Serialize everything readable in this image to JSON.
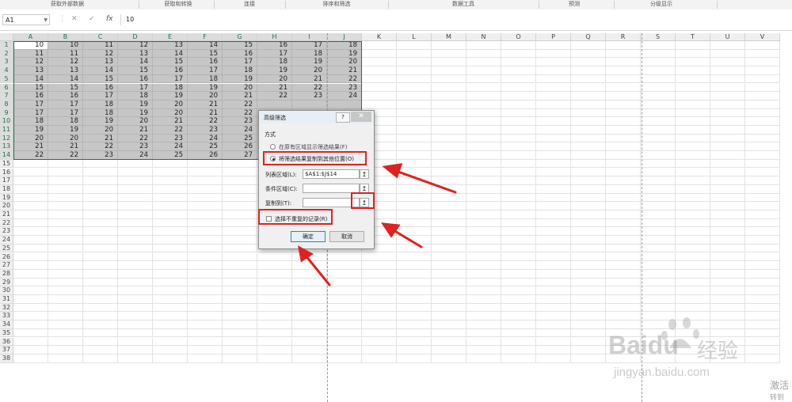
{
  "ribbon": {
    "groups": [
      "获取外部数据",
      "获取和转换",
      "连接",
      "排序和筛选",
      "数据工具",
      "预测",
      "分级显示"
    ]
  },
  "formula_bar": {
    "name_box": "A1",
    "cancel_icon": "✕",
    "enter_icon": "✓",
    "fx_icon": "fx",
    "value": "10"
  },
  "sheet": {
    "columns": [
      "A",
      "B",
      "C",
      "D",
      "E",
      "F",
      "G",
      "H",
      "I",
      "J",
      "K",
      "L",
      "M",
      "N",
      "O",
      "P",
      "Q",
      "R",
      "S",
      "T",
      "U",
      "V"
    ],
    "row_numbers": [
      "1",
      "2",
      "3",
      "4",
      "5",
      "6",
      "7",
      "8",
      "9",
      "10",
      "11",
      "12",
      "13",
      "14",
      "15",
      "16",
      "17",
      "18",
      "19",
      "20",
      "21",
      "22",
      "23",
      "24",
      "25",
      "26",
      "27",
      "28",
      "29",
      "30",
      "31",
      "32",
      "33",
      "34",
      "35",
      "36",
      "37",
      "38"
    ],
    "selected_columns": [
      "A",
      "B",
      "C",
      "D",
      "E",
      "F",
      "G",
      "H",
      "I",
      "J"
    ],
    "data_rows": [
      [
        "10",
        "10",
        "11",
        "12",
        "13",
        "14",
        "15",
        "16",
        "17",
        "18"
      ],
      [
        "11",
        "11",
        "12",
        "13",
        "14",
        "15",
        "16",
        "17",
        "18",
        "19"
      ],
      [
        "12",
        "12",
        "13",
        "14",
        "15",
        "16",
        "17",
        "18",
        "19",
        "20"
      ],
      [
        "13",
        "13",
        "14",
        "15",
        "16",
        "17",
        "18",
        "19",
        "20",
        "21"
      ],
      [
        "14",
        "14",
        "15",
        "16",
        "17",
        "18",
        "19",
        "20",
        "21",
        "22"
      ],
      [
        "15",
        "15",
        "16",
        "17",
        "18",
        "19",
        "20",
        "21",
        "22",
        "23"
      ],
      [
        "16",
        "16",
        "17",
        "18",
        "19",
        "20",
        "21",
        "22",
        "23",
        "24"
      ],
      [
        "17",
        "17",
        "18",
        "19",
        "20",
        "21",
        "22",
        "",
        "",
        ""
      ],
      [
        "17",
        "17",
        "18",
        "19",
        "20",
        "21",
        "22",
        "",
        "",
        ""
      ],
      [
        "18",
        "18",
        "19",
        "20",
        "21",
        "22",
        "23",
        "",
        "",
        ""
      ],
      [
        "19",
        "19",
        "20",
        "21",
        "22",
        "23",
        "24",
        "",
        "",
        ""
      ],
      [
        "20",
        "20",
        "21",
        "22",
        "23",
        "24",
        "25",
        "",
        "",
        ""
      ],
      [
        "21",
        "21",
        "22",
        "23",
        "24",
        "25",
        "26",
        "",
        "",
        ""
      ],
      [
        "22",
        "22",
        "23",
        "24",
        "25",
        "26",
        "27",
        "",
        "",
        ""
      ]
    ]
  },
  "dialog": {
    "title": "高级筛选",
    "help": "?",
    "close": "✕",
    "mode_label": "方式",
    "option_inplace": "在原有区域显示筛选结果(F)",
    "option_copy": "将筛选结果复制到其他位置(O)",
    "option_selected": "copy",
    "list_range_label": "列表区域(L):",
    "list_range_value": "$A$1:$J$14",
    "criteria_range_label": "条件区域(C):",
    "criteria_range_value": "",
    "copy_to_label": "复制到(T):",
    "copy_to_value": "",
    "unique_label": "选择不重复的记录(R)",
    "unique_checked": false,
    "ok": "确定",
    "cancel": "取消",
    "ref_icon": "↥"
  },
  "colors": {
    "excel_green": "#217346",
    "annotation_red": "#e0221f",
    "selection_gray": "#c6c6c6"
  },
  "watermark": {
    "brand": "Bai",
    "brand2": "du",
    "cn": "经验",
    "url": "jingyan.baidu.com",
    "activate": "激活",
    "activate2": "转到"
  }
}
